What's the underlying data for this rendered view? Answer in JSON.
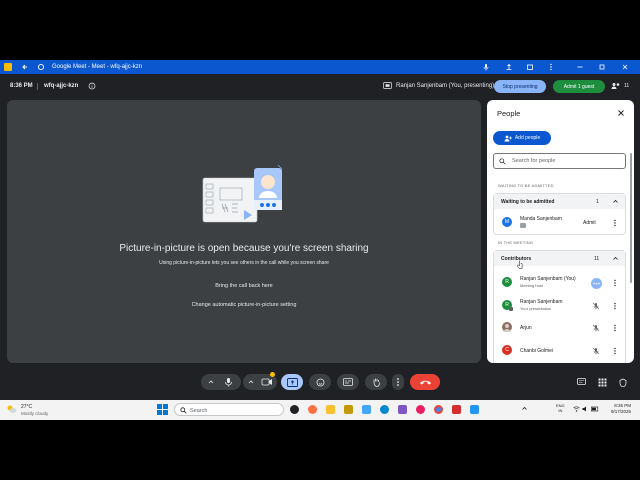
{
  "browser": {
    "tab_title": "Google Meet - Meet - wfq-ajjc-kzn"
  },
  "meeting": {
    "time": "8:36 PM",
    "code": "wfq-ajjc-kzn",
    "presenting_label": "Ranjan Sanjenbam (You, presenting)",
    "stop_presenting_label": "Stop presenting",
    "admit_guest_label": "Admit 1 guest",
    "participant_count": "11"
  },
  "stage": {
    "title": "Picture-in-picture is open because you're screen sharing",
    "subtitle": "Using picture-in-picture lets you see others in the call while you screen share",
    "bring_back_label": "Bring the call back here",
    "change_setting_label": "Change automatic picture-in-picture setting"
  },
  "people": {
    "title": "People",
    "add_people_label": "Add people",
    "search_placeholder": "Search for people",
    "waiting_section_label": "WAITING TO BE ADMITTED",
    "waiting_group": {
      "label": "Waiting to be admitted",
      "count": "1"
    },
    "waiting": [
      {
        "name": "Manda Sanjenbam",
        "initial": "M",
        "avatar_color": "#1a73e8",
        "action": "Admit"
      }
    ],
    "meeting_section_label": "IN THE MEETING",
    "contributors_group": {
      "label": "Contributors",
      "count": "11"
    },
    "participants": [
      {
        "name": "Ranjan Sanjenbam (You)",
        "role": "Meeting host",
        "initial": "R",
        "avatar_color": "#1e8e3e"
      },
      {
        "name": "Ranjan Sanjenbam",
        "role": "Your presentation",
        "initial": "R",
        "avatar_color": "#1e8e3e"
      },
      {
        "name": "Arjun",
        "role": "",
        "initial": "",
        "avatar_color": "#8d6e63"
      },
      {
        "name": "Chanbi Golmei",
        "role": "",
        "initial": "C",
        "avatar_color": "#d93025"
      }
    ]
  },
  "taskbar": {
    "weather_temp": "27°C",
    "weather_desc": "Mostly cloudy",
    "search_label": "Search",
    "lang_top": "ENG",
    "lang_bottom": "IN",
    "clock_time": "8:36 PM",
    "clock_date": "9/17/2026"
  },
  "colors": {
    "meet_bg": "#202124",
    "stage_bg": "#3c4043",
    "accent": "#8ab4f8",
    "end_call": "#ea4335",
    "titlebar": "#0b57d0"
  }
}
